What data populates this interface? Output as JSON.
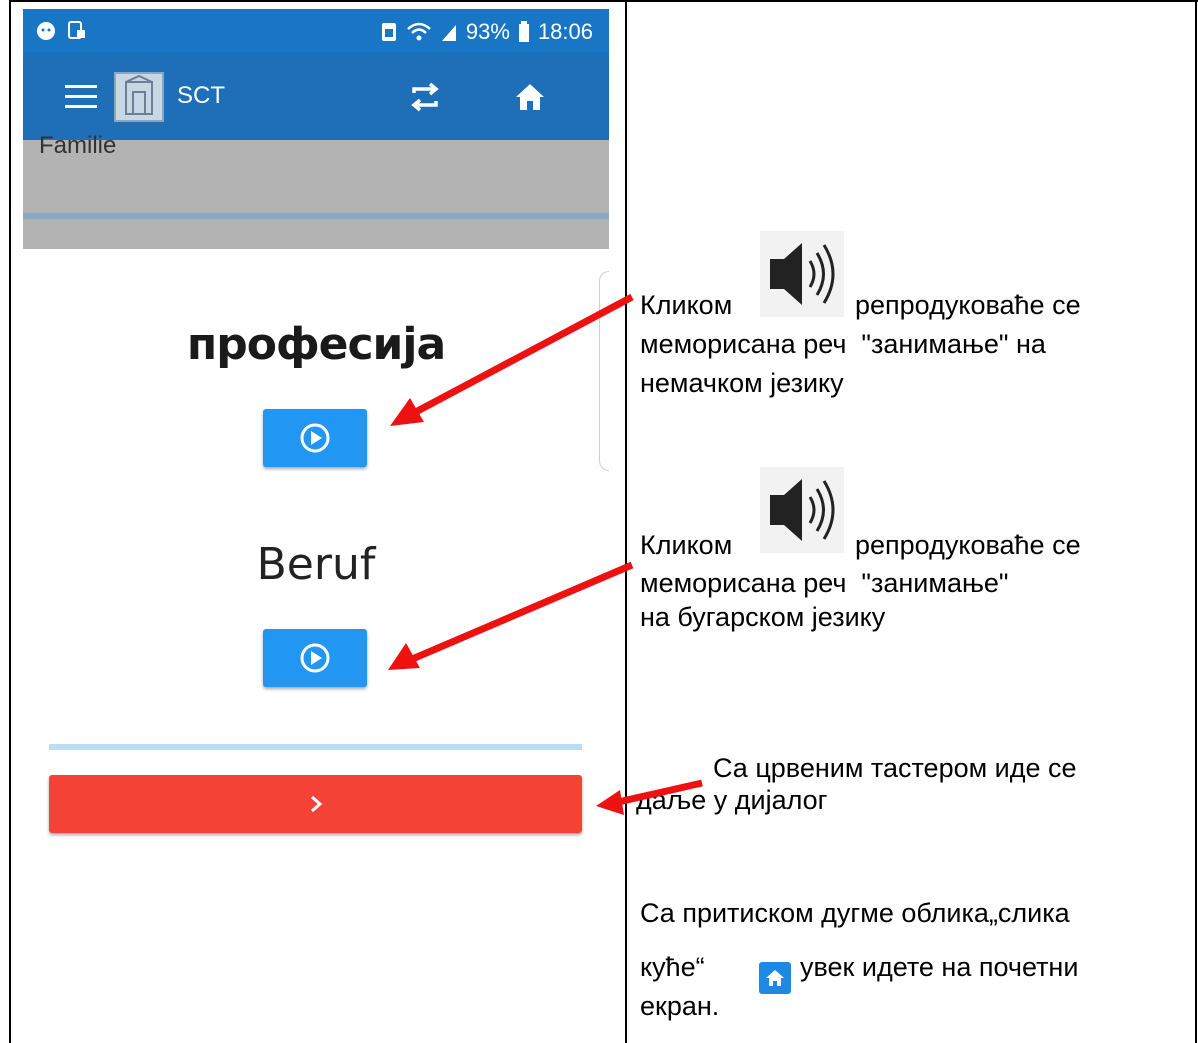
{
  "status_bar": {
    "battery_percent": "93%",
    "time": "18:06"
  },
  "app_bar": {
    "title": "SCT",
    "menu_icon": "menu-icon",
    "repeat_icon": "repeat-icon",
    "home_icon": "home-icon"
  },
  "previous_card": {
    "text": "Familie"
  },
  "card": {
    "word_primary": "професија",
    "word_secondary": "Beruf",
    "play_icon": "play-circle-icon",
    "next_icon": "chevron-right-icon"
  },
  "colors": {
    "app_bar": "#1e6eb8",
    "play_button": "#2196f3",
    "next_button": "#f44336",
    "arrow": "#ee1111"
  },
  "notes": {
    "note1": {
      "prefix": "Кликом",
      "suffix": "репродуковаће се",
      "line2": "меморисана реч  \"занимање\" на",
      "line3": "немачком језику"
    },
    "note2": {
      "prefix": "Кликом",
      "suffix": "репродуковаће се",
      "line2": "меморисана реч  \"занимање\"",
      "line3": "на бугарском језику"
    },
    "note3": {
      "line1": "Са црвеним тастером иде се",
      "line2": "даље у дијалог"
    },
    "note4": {
      "line1": "Са притиском дугме облика„слика",
      "line2_prefix": "куће“",
      "line2_suffix": "увек идете на почетни",
      "line3": "екран."
    }
  }
}
